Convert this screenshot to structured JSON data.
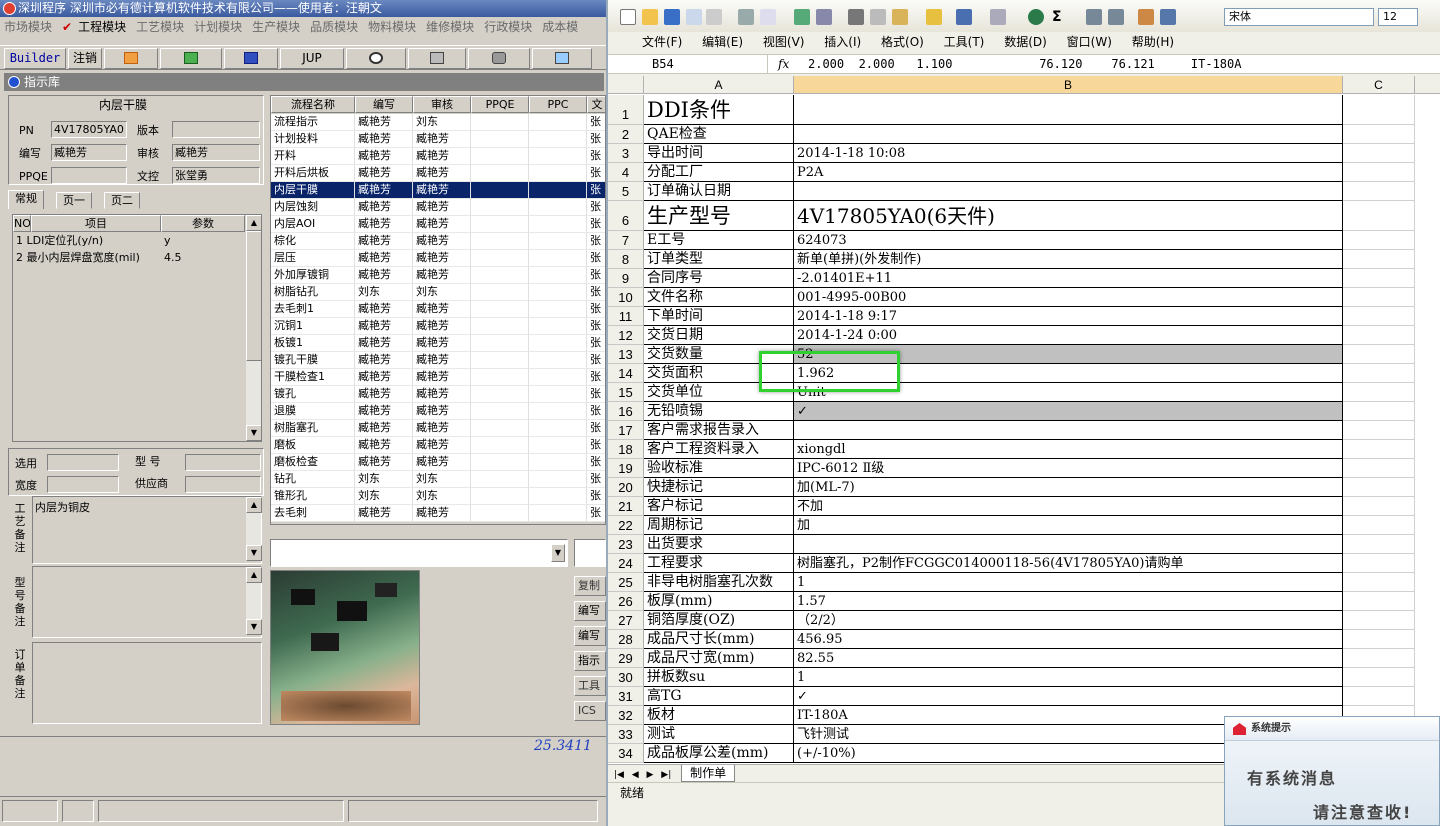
{
  "left_app": {
    "title": "深圳程序    深圳市必有德计算机软件技术有限公司——使用者：汪朝文",
    "menu": [
      "市场模块",
      "工程模块",
      "工艺模块",
      "计划模块",
      "生产模块",
      "品质模块",
      "物料模块",
      "维修模块",
      "行政模块",
      "成本模"
    ],
    "toolbar": {
      "builder": "Builder",
      "logout": "注销",
      "jup": "JUP"
    },
    "subtitle": "指示库",
    "form": {
      "header": "内层干膜",
      "pn_label": "PN",
      "pn_value": "4V17805YA0",
      "version_label": "版本",
      "version_value": "",
      "author_label": "编写",
      "author_value": "臧艳芳",
      "review_label": "审核",
      "review_value": "臧艳芳",
      "ppqe_label": "PPQE",
      "ppqe_value": "",
      "control_label": "文控",
      "control_value": "张堂勇"
    },
    "tabs": [
      "常规",
      "页一",
      "页二"
    ],
    "param_table": {
      "headers": [
        "NO",
        "项目",
        "参数"
      ],
      "rows": [
        [
          "1",
          "LDI定位孔(y/n)",
          "y"
        ],
        [
          "2",
          "最小内层焊盘宽度(mil)",
          "4.5"
        ]
      ]
    },
    "lower": {
      "use_label": "选用",
      "model_label": "型  号",
      "width_label": "宽度",
      "supplier_label": "供应商",
      "craft_label": "工艺备注",
      "craft_text": "内层为铜皮",
      "model_note_label": "型号备注",
      "order_note_label": "订单备注"
    },
    "flow_table": {
      "headers": [
        "流程名称",
        "编写",
        "审核",
        "PPQE",
        "PPC",
        "文"
      ],
      "rows": [
        [
          "流程指示",
          "臧艳芳",
          "刘东",
          "",
          "",
          "张"
        ],
        [
          "计划投料",
          "臧艳芳",
          "臧艳芳",
          "",
          "",
          "张"
        ],
        [
          "开料",
          "臧艳芳",
          "臧艳芳",
          "",
          "",
          "张"
        ],
        [
          "开料后烘板",
          "臧艳芳",
          "臧艳芳",
          "",
          "",
          "张"
        ],
        [
          "内层干膜",
          "臧艳芳",
          "臧艳芳",
          "",
          "",
          "张"
        ],
        [
          "内层蚀刻",
          "臧艳芳",
          "臧艳芳",
          "",
          "",
          "张"
        ],
        [
          "内层AOI",
          "臧艳芳",
          "臧艳芳",
          "",
          "",
          "张"
        ],
        [
          "棕化",
          "臧艳芳",
          "臧艳芳",
          "",
          "",
          "张"
        ],
        [
          "层压",
          "臧艳芳",
          "臧艳芳",
          "",
          "",
          "张"
        ],
        [
          "外加厚镀铜",
          "臧艳芳",
          "臧艳芳",
          "",
          "",
          "张"
        ],
        [
          "树脂钻孔",
          "刘东",
          "刘东",
          "",
          "",
          "张"
        ],
        [
          "去毛刺1",
          "臧艳芳",
          "臧艳芳",
          "",
          "",
          "张"
        ],
        [
          "沉铜1",
          "臧艳芳",
          "臧艳芳",
          "",
          "",
          "张"
        ],
        [
          "板镀1",
          "臧艳芳",
          "臧艳芳",
          "",
          "",
          "张"
        ],
        [
          "镀孔干膜",
          "臧艳芳",
          "臧艳芳",
          "",
          "",
          "张"
        ],
        [
          "干膜检查1",
          "臧艳芳",
          "臧艳芳",
          "",
          "",
          "张"
        ],
        [
          "镀孔",
          "臧艳芳",
          "臧艳芳",
          "",
          "",
          "张"
        ],
        [
          "退膜",
          "臧艳芳",
          "臧艳芳",
          "",
          "",
          "张"
        ],
        [
          "树脂塞孔",
          "臧艳芳",
          "臧艳芳",
          "",
          "",
          "张"
        ],
        [
          "磨板",
          "臧艳芳",
          "臧艳芳",
          "",
          "",
          "张"
        ],
        [
          "磨板检查",
          "臧艳芳",
          "臧艳芳",
          "",
          "",
          "张"
        ],
        [
          "钻孔",
          "刘东",
          "刘东",
          "",
          "",
          "张"
        ],
        [
          "锥形孔",
          "刘东",
          "刘东",
          "",
          "",
          "张"
        ],
        [
          "去毛刺",
          "臧艳芳",
          "臧艳芳",
          "",
          "",
          "张"
        ]
      ],
      "selected_index": 4
    },
    "side_buttons": [
      "复制",
      "编写",
      "编写",
      "指示",
      "工具",
      "ICS"
    ],
    "handwriting": "25.3411"
  },
  "excel": {
    "font_name": "宋体",
    "font_size": "12",
    "menu": [
      "文件(F)",
      "编辑(E)",
      "视图(V)",
      "插入(I)",
      "格式(O)",
      "工具(T)",
      "数据(D)",
      "窗口(W)",
      "帮助(H)"
    ],
    "name_box": "B54",
    "fx": "fx",
    "formula": "2.000  2.000   1.100            76.120    76.121     IT-180A",
    "columns": [
      "A",
      "B",
      "C"
    ],
    "rows": [
      {
        "n": "1",
        "a": "DDI条件",
        "b": "",
        "big": true
      },
      {
        "n": "2",
        "a": "QAE检查",
        "b": ""
      },
      {
        "n": "3",
        "a": "导出时间",
        "b": "2014-1-18 10:08"
      },
      {
        "n": "4",
        "a": "分配工厂",
        "b": "P2A"
      },
      {
        "n": "5",
        "a": "订单确认日期",
        "b": ""
      },
      {
        "n": "6",
        "a": "生产型号",
        "b": "4V17805YA0(6天件)",
        "big": true
      },
      {
        "n": "7",
        "a": "E工号",
        "b": "624073"
      },
      {
        "n": "8",
        "a": "订单类型",
        "b": "新单(单拼)(外发制作)"
      },
      {
        "n": "9",
        "a": "合同序号",
        "b": "-2.01401E+11"
      },
      {
        "n": "10",
        "a": "文件名称",
        "b": "001-4995-00B00"
      },
      {
        "n": "11",
        "a": "下单时间",
        "b": "2014-1-18 9:17"
      },
      {
        "n": "12",
        "a": "交货日期",
        "b": "2014-1-24 0:00"
      },
      {
        "n": "13",
        "a": "交货数量",
        "b": "52",
        "gray": true
      },
      {
        "n": "14",
        "a": "交货面积",
        "b": "1.962"
      },
      {
        "n": "15",
        "a": "交货单位",
        "b": "Unit"
      },
      {
        "n": "16",
        "a": "无铅喷锡",
        "b": "✓",
        "gray": true
      },
      {
        "n": "17",
        "a": "客户需求报告录入",
        "b": ""
      },
      {
        "n": "18",
        "a": "客户工程资料录入",
        "b": "xiongdl"
      },
      {
        "n": "19",
        "a": "验收标准",
        "b": "IPC-6012 Ⅱ级"
      },
      {
        "n": "20",
        "a": "快捷标记",
        "b": "加(ML-7)"
      },
      {
        "n": "21",
        "a": "客户标记",
        "b": "不加"
      },
      {
        "n": "22",
        "a": "周期标记",
        "b": "加"
      },
      {
        "n": "23",
        "a": "出货要求",
        "b": ""
      },
      {
        "n": "24",
        "a": "工程要求",
        "b": "树脂塞孔，P2制作FCGGC014000118-56(4V17805YA0)请购单"
      },
      {
        "n": "25",
        "a": "非导电树脂塞孔次数",
        "b": "1"
      },
      {
        "n": "26",
        "a": "板厚(mm)",
        "b": "1.57"
      },
      {
        "n": "27",
        "a": "铜箔厚度(OZ)",
        "b": "（2/2）"
      },
      {
        "n": "28",
        "a": "成品尺寸长(mm)",
        "b": "456.95"
      },
      {
        "n": "29",
        "a": "成品尺寸宽(mm)",
        "b": "82.55"
      },
      {
        "n": "30",
        "a": "拼板数su",
        "b": "1"
      },
      {
        "n": "31",
        "a": "高TG",
        "b": "✓"
      },
      {
        "n": "32",
        "a": "板材",
        "b": "IT-180A"
      },
      {
        "n": "33",
        "a": "测试",
        "b": "飞针测试"
      },
      {
        "n": "34",
        "a": "成品板厚公差(mm)",
        "b": "(+/-10%)"
      }
    ],
    "sheet_tab": "制作单",
    "status": "就绪"
  },
  "popup": {
    "title": "系统提示",
    "line1": "有系统消息",
    "line2": "请注意查收!"
  }
}
